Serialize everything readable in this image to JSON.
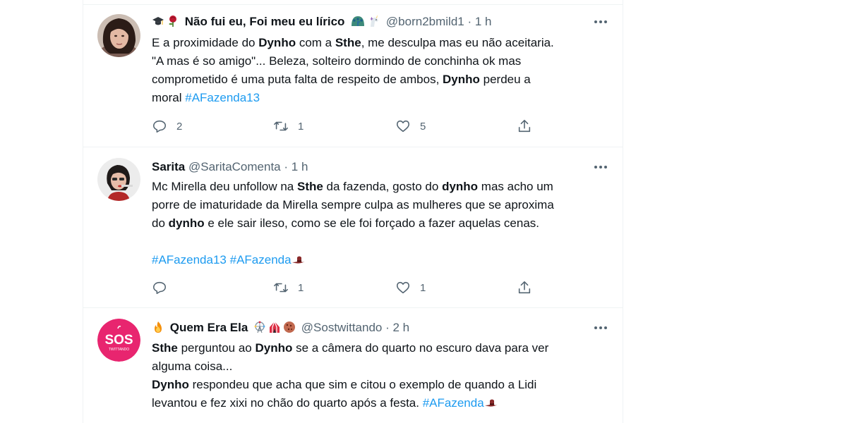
{
  "tweets": [
    {
      "name": "Não fui eu, Foi meu eu lírico",
      "handle": "@born2bmild1",
      "dot": "·",
      "time": "1 h",
      "lines": [
        [
          {
            "t": "E a proximidade do "
          },
          {
            "t": "Dynho",
            "b": true
          },
          {
            "t": " com a "
          },
          {
            "t": "Sthe",
            "b": true
          },
          {
            "t": ", me desculpa mas eu não aceitaria."
          }
        ],
        [
          {
            "t": "\"A mas é so amigo\"... Beleza, solteiro dormindo de conchinha ok mas"
          }
        ],
        [
          {
            "t": "comprometido é uma puta falta de respeito de ambos, "
          },
          {
            "t": "Dynho",
            "b": true
          },
          {
            "t": " perdeu a"
          }
        ],
        [
          {
            "t": "moral "
          },
          {
            "t": "#AFazenda13",
            "tag": true
          }
        ]
      ],
      "replies": "2",
      "retweets": "1",
      "likes": "5"
    },
    {
      "name": "Sarita",
      "handle": "@SaritaComenta",
      "dot": "·",
      "time": "1 h",
      "lines": [
        [
          {
            "t": "Mc Mirella deu unfollow na "
          },
          {
            "t": "Sthe",
            "b": true
          },
          {
            "t": " da fazenda, gosto do "
          },
          {
            "t": "dynho",
            "b": true
          },
          {
            "t": " mas acho um"
          }
        ],
        [
          {
            "t": "porre de imaturidade da Mirella sempre culpa as mulheres que se aproxima"
          }
        ],
        [
          {
            "t": "do "
          },
          {
            "t": "dynho",
            "b": true
          },
          {
            "t": " e ele sair ileso, como se ele foi forçado a fazer aquelas cenas."
          }
        ],
        [],
        [
          {
            "t": "#AFazenda13",
            "tag": true
          },
          {
            "t": " "
          },
          {
            "t": "#AFazenda",
            "tag": true
          },
          {
            "t": "",
            "hat": true
          }
        ]
      ],
      "replies": "",
      "retweets": "1",
      "likes": "1"
    },
    {
      "name": "Quem Era Ela",
      "handle": "@Sostwittando",
      "dot": "·",
      "time": "2 h",
      "avatar_text": "SOS",
      "avatar_sub": "TWITTANDO",
      "lines": [
        [
          {
            "t": "Sthe",
            "b": true
          },
          {
            "t": " perguntou ao "
          },
          {
            "t": "Dynho",
            "b": true
          },
          {
            "t": " se a câmera do quarto no escuro dava para ver"
          }
        ],
        [
          {
            "t": "alguma coisa..."
          }
        ],
        [
          {
            "t": "Dynho",
            "b": true
          },
          {
            "t": " respondeu que acha que sim e citou o exemplo de quando a Lidi"
          }
        ],
        [
          {
            "t": "levantou e fez xixi no chão do quarto após a festa. "
          },
          {
            "t": "#AFazenda",
            "tag": true
          },
          {
            "t": "",
            "hat": true
          }
        ]
      ]
    }
  ],
  "icons": {
    "reply": "reply-icon",
    "retweet": "retweet-icon",
    "like": "like-icon",
    "share": "share-icon",
    "more": "more-icon"
  },
  "colors": {
    "hashtag": "#1d9bf0",
    "secondary_text": "#536471",
    "avatar_pink": "#e8256f"
  }
}
